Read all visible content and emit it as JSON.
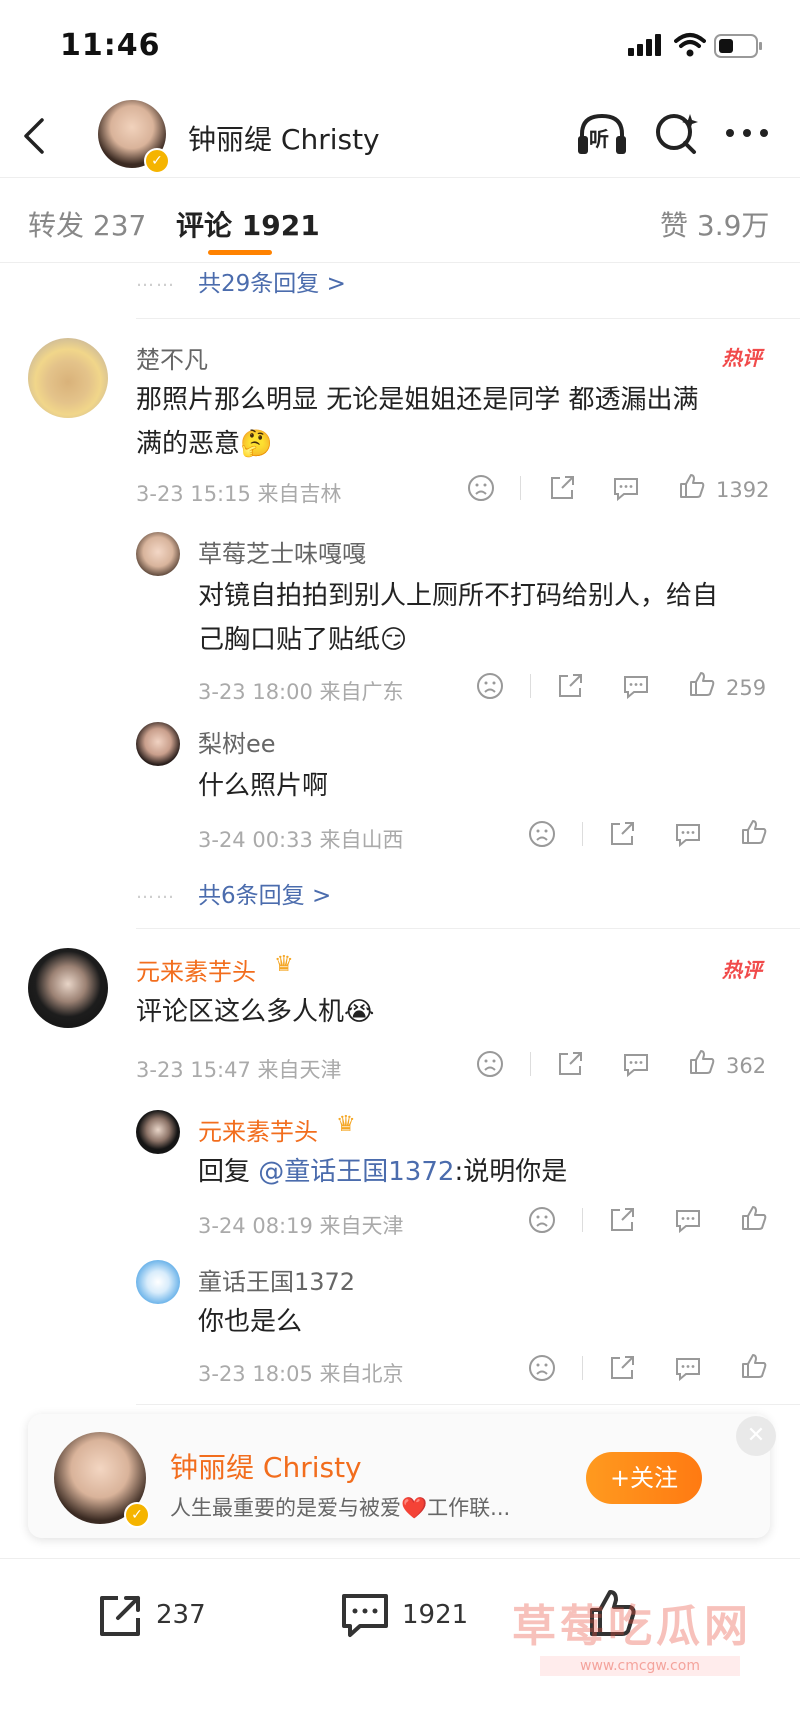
{
  "status_bar": {
    "time": "11:46"
  },
  "header": {
    "title": "钟丽缇 Christy",
    "listen_label": "听"
  },
  "tabs": [
    {
      "label": "转发 237"
    },
    {
      "label": "评论 1921"
    },
    {
      "label": "赞 3.9万"
    }
  ],
  "top_more": {
    "dots": "……",
    "label": "共29条回复 >"
  },
  "comments": [
    {
      "name": "楚不凡",
      "hot": "热评",
      "text_line1": "那照片那么明显 无论是姐姐还是同学 都透漏出满",
      "text_line2": "满的恶意🤔",
      "meta": "3-23 15:15  来自吉林",
      "likes": "1392",
      "replies": [
        {
          "name": "草莓芝士味嘎嘎",
          "text_line1": "对镜自拍拍到别人上厕所不打码给别人，给自",
          "text_line2": "己胸口贴了贴纸😏",
          "meta": "3-23 18:00  来自广东",
          "likes": "259"
        },
        {
          "name": "梨树ee",
          "text_line1": "什么照片啊",
          "meta": "3-24 00:33  来自山西",
          "likes": ""
        }
      ],
      "more_dots": "……",
      "more_label": "共6条回复 >"
    },
    {
      "name": "元来素芋头",
      "hot": "热评",
      "text_line1": "评论区这么多人机😭",
      "meta": "3-23 15:47  来自天津",
      "likes": "362",
      "replies": [
        {
          "name": "元来素芋头",
          "reply_prefix": "回复 ",
          "mention": "@童话王国1372",
          "text_rest": ":说明你是",
          "meta": "3-24 08:19  来自天津",
          "likes": ""
        },
        {
          "name": "童话王国1372",
          "text_line1": "你也是么",
          "meta": "3-23 18:05  来自北京",
          "likes": ""
        }
      ]
    }
  ],
  "follow_card": {
    "name": "钟丽缇 Christy",
    "bio": "人生最重要的是爱与被爱❤️工作联...",
    "button": "+关注"
  },
  "bottom_bar": {
    "repost_count": "237",
    "comment_count": "1921"
  },
  "watermark": {
    "text": "草莓吃瓜网",
    "url": "www.cmcgw.com"
  },
  "colors": {
    "accent": "#f26d1d",
    "link": "#4b6cad",
    "hot": "#f14b4b",
    "tab_underline": "#ff8200"
  }
}
